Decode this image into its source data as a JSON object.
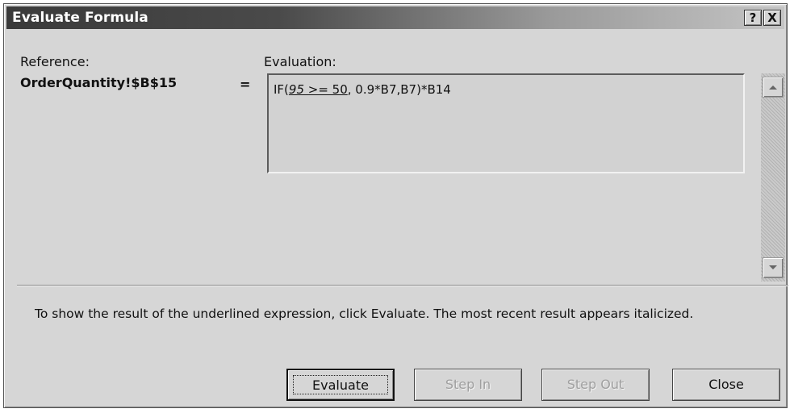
{
  "window": {
    "title": "Evaluate Formula",
    "help_button": "?",
    "close_button": "X"
  },
  "reference": {
    "label": "Reference:",
    "value": "OrderQuantity!$B$15",
    "equals": "="
  },
  "evaluation": {
    "label": "Evaluation:",
    "formula_prefix": "IF(",
    "underlined_part": "95 >= 50",
    "underlined_italic": "95",
    "underlined_rest": " >= 50",
    "formula_suffix": ", 0.9*B7,B7)*B14"
  },
  "description": "To show the result of the underlined expression, click Evaluate.  The most recent result appears italicized.",
  "buttons": {
    "evaluate": "Evaluate",
    "step_in": "Step In",
    "step_out": "Step Out",
    "close": "Close"
  },
  "icons": {
    "scroll_up": "arrow-up-icon",
    "scroll_down": "arrow-down-icon"
  }
}
